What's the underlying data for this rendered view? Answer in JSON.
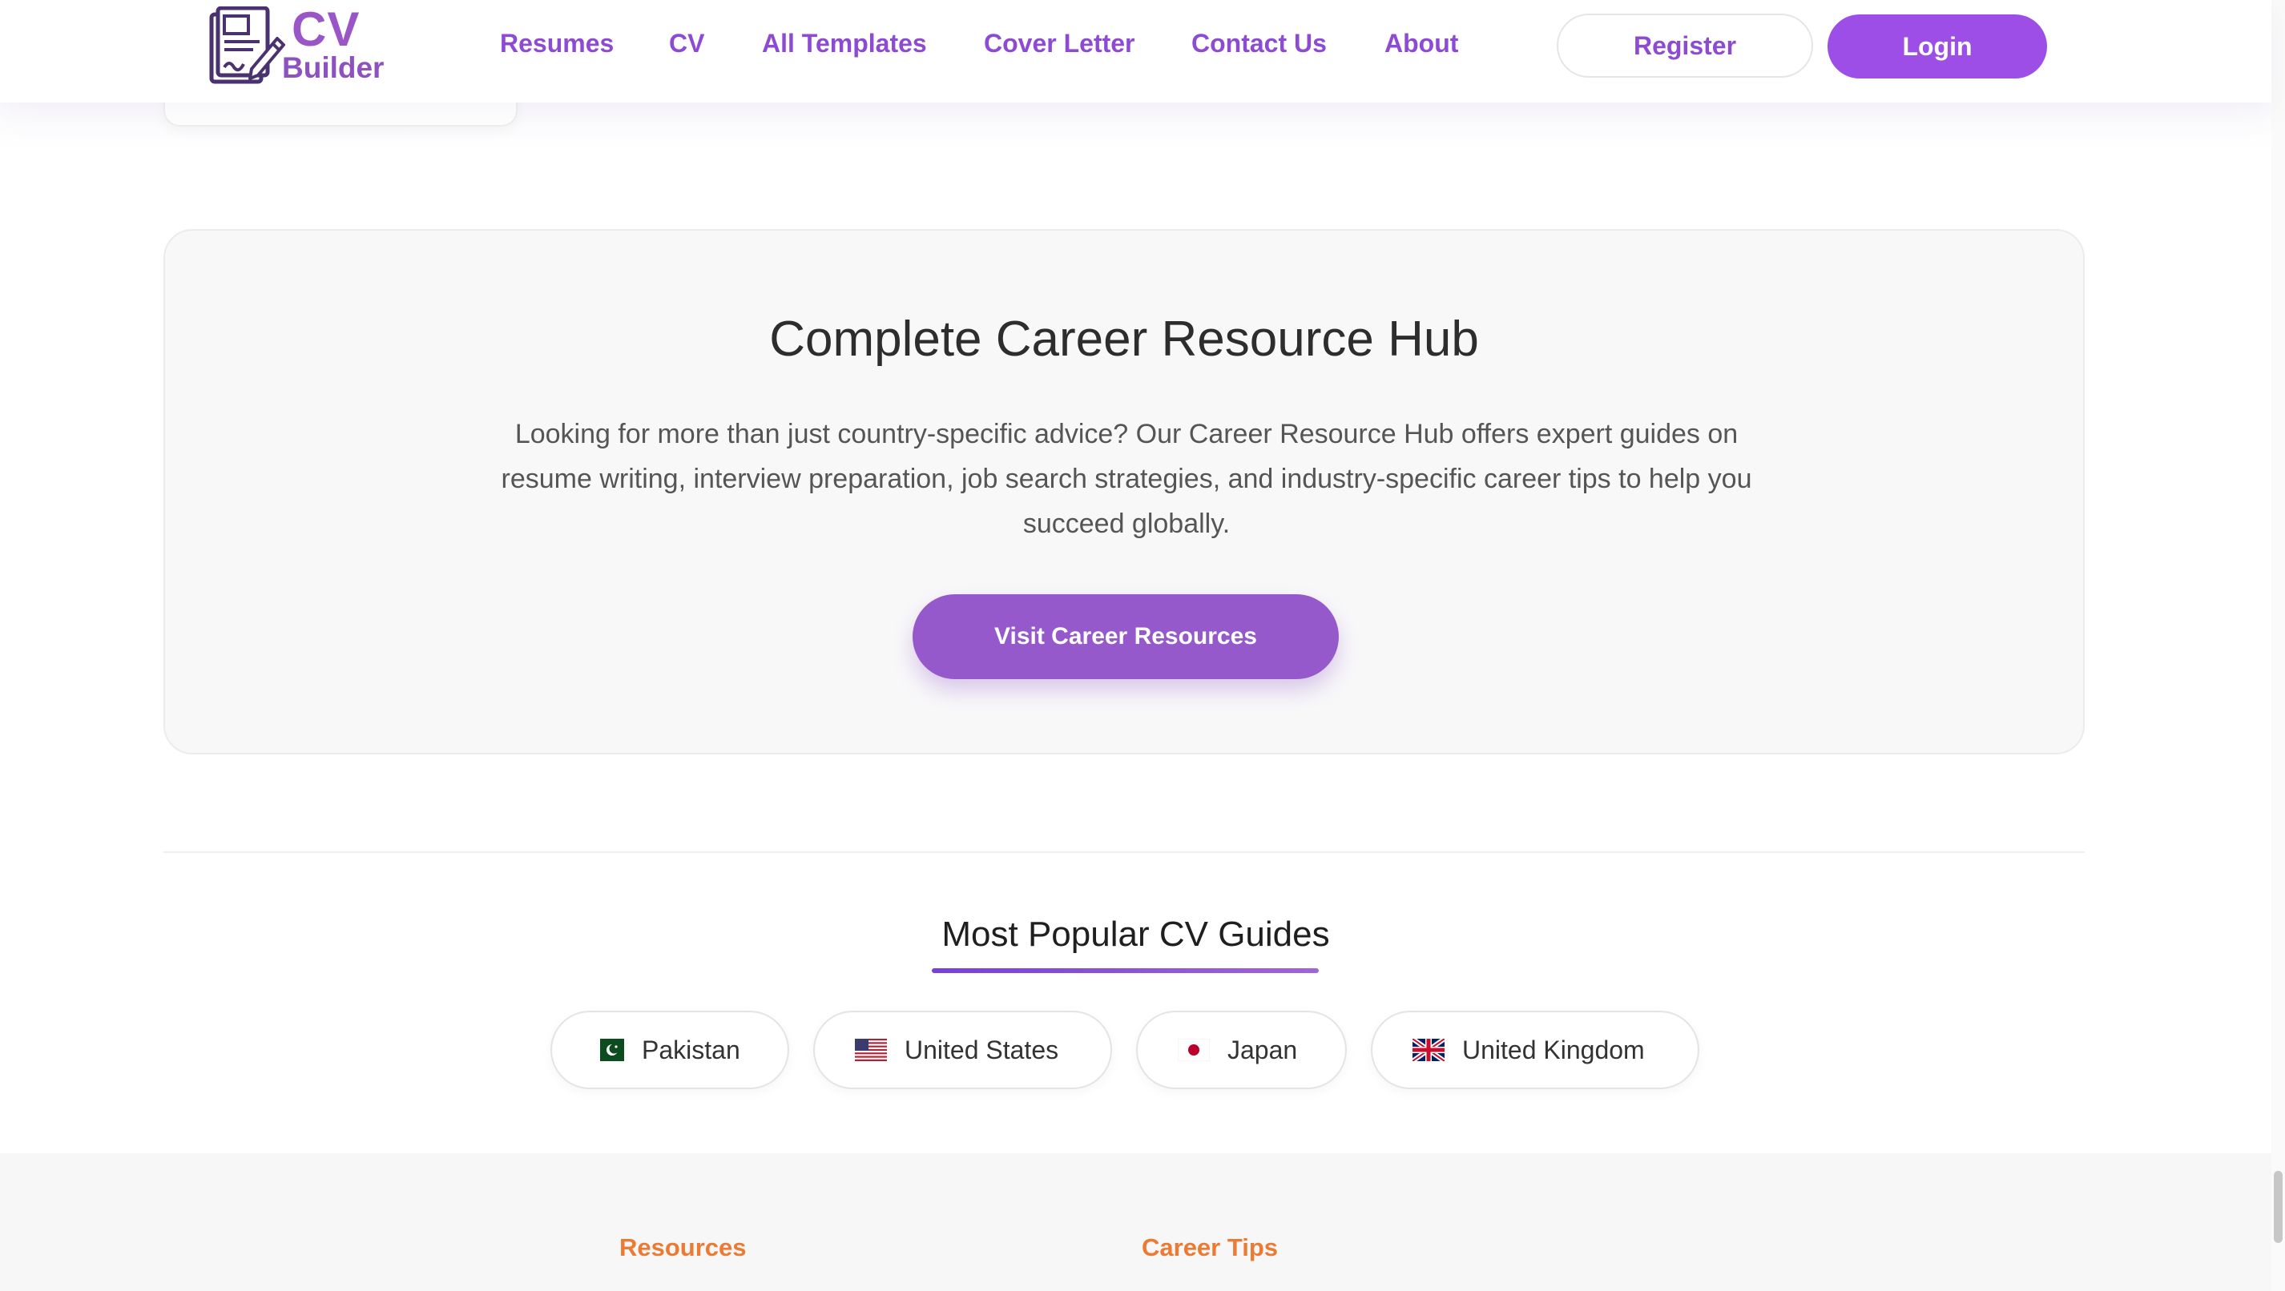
{
  "header": {
    "logo": {
      "top": "CV",
      "bottom": "Builder"
    },
    "nav": [
      "Resumes",
      "CV",
      "All Templates",
      "Cover Letter",
      "Contact Us",
      "About"
    ],
    "register_label": "Register",
    "login_label": "Login"
  },
  "hub": {
    "title": "Complete Career Resource Hub",
    "description": "Looking for more than just country-specific advice? Our Career Resource Hub offers expert guides on resume writing, interview preparation, job search strategies, and industry-specific career tips to help you succeed globally.",
    "button_label": "Visit Career Resources"
  },
  "popular": {
    "title": "Most Popular CV Guides",
    "countries": [
      {
        "name": "Pakistan",
        "flag": "pakistan-flag-icon"
      },
      {
        "name": "United States",
        "flag": "us-flag-icon"
      },
      {
        "name": "Japan",
        "flag": "japan-flag-icon"
      },
      {
        "name": "United Kingdom",
        "flag": "uk-flag-icon"
      }
    ]
  },
  "footer": {
    "columns": [
      {
        "heading": "Resources"
      },
      {
        "heading": "Career Tips"
      }
    ]
  },
  "colors": {
    "brand_purple": "#9d4ee6",
    "nav_purple": "#8d4bd3",
    "hub_button": "#9559cb",
    "footer_heading": "#ec7a32"
  }
}
